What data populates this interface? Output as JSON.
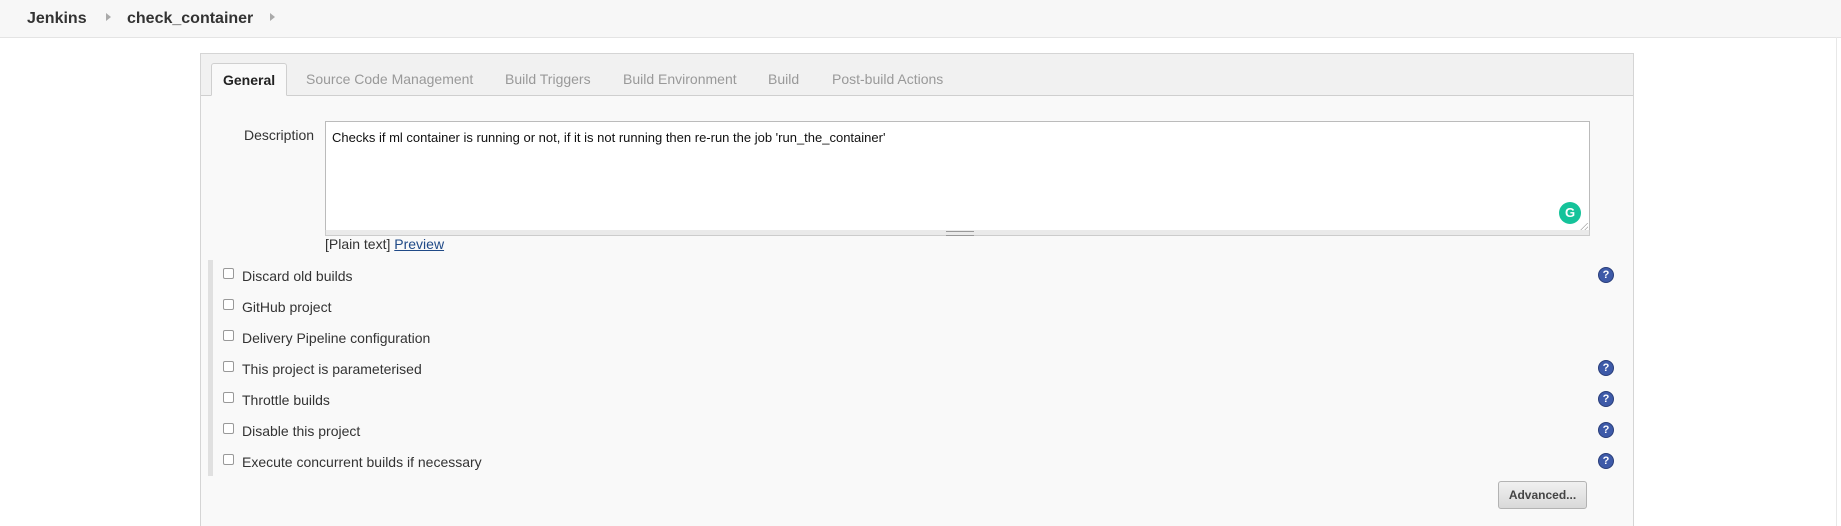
{
  "breadcrumb": {
    "items": [
      {
        "label": "Jenkins"
      },
      {
        "label": "check_container"
      }
    ]
  },
  "tabs": [
    {
      "label": "General",
      "active": true
    },
    {
      "label": "Source Code Management"
    },
    {
      "label": "Build Triggers"
    },
    {
      "label": "Build Environment"
    },
    {
      "label": "Build"
    },
    {
      "label": "Post-build Actions"
    }
  ],
  "description": {
    "label": "Description",
    "value": "Checks if ml container is running or not, if it is not running then re-run the job 'run_the_container'",
    "format_prefix": "[Plain text]",
    "preview_link": "Preview",
    "grammarly_glyph": "G"
  },
  "options": [
    {
      "label": "Discard old builds",
      "checked": false,
      "help": true
    },
    {
      "label": "GitHub project",
      "checked": false,
      "help": false
    },
    {
      "label": "Delivery Pipeline configuration",
      "checked": false,
      "help": false
    },
    {
      "label": "This project is parameterised",
      "checked": false,
      "help": true
    },
    {
      "label": "Throttle builds",
      "checked": false,
      "help": true
    },
    {
      "label": "Disable this project",
      "checked": false,
      "help": true
    },
    {
      "label": "Execute concurrent builds if necessary",
      "checked": false,
      "help": true
    }
  ],
  "help_glyph": "?",
  "advanced_button": "Advanced...",
  "colors": {
    "link": "#204a87",
    "help_icon": "#3e5aa8",
    "grammarly": "#15c39a"
  }
}
